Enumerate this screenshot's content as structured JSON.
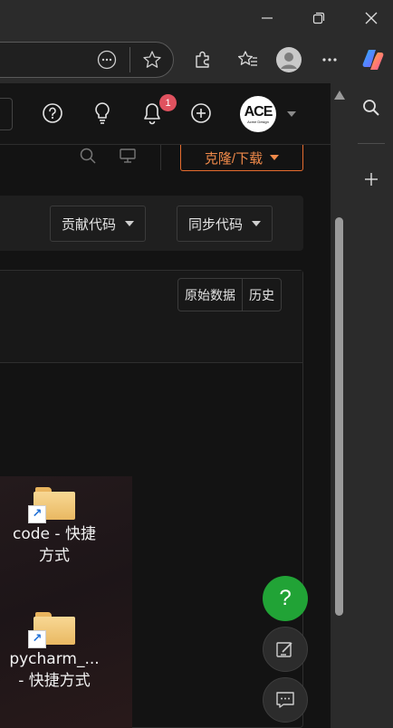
{
  "window_controls": {
    "minimize": "minimize-icon",
    "restore": "restore-icon",
    "close": "close-icon"
  },
  "browser_toolbar": {
    "icons": [
      "more-dots-icon",
      "favorite-star-icon",
      "extensions-icon",
      "favorites-icon",
      "profile-icon",
      "menu-more-icon",
      "copilot-icon"
    ]
  },
  "edge_sidebar": {
    "icons": [
      "sidebar-search-icon",
      "sidebar-add-icon"
    ]
  },
  "site_header": {
    "notification_count": "1",
    "avatar_logo": "ACE",
    "avatar_subtext": "Acme Design"
  },
  "repo_bar": {
    "clone_label": "克隆/下载"
  },
  "actions": {
    "contribute_label": "贡献代码",
    "sync_label": "同步代码"
  },
  "file_view": {
    "raw_label": "原始数据",
    "history_label": "历史"
  },
  "desktop_icons": {
    "item1_line1": "code - 快捷",
    "item1_line2": "方式",
    "item2_line1": "pycharm_...",
    "item2_line2": "- 快捷方式"
  },
  "fab": {
    "help_label": "?"
  },
  "colors": {
    "accent_orange": "#e66c2e",
    "help_green": "#21a336",
    "badge_red": "#e0525f"
  }
}
